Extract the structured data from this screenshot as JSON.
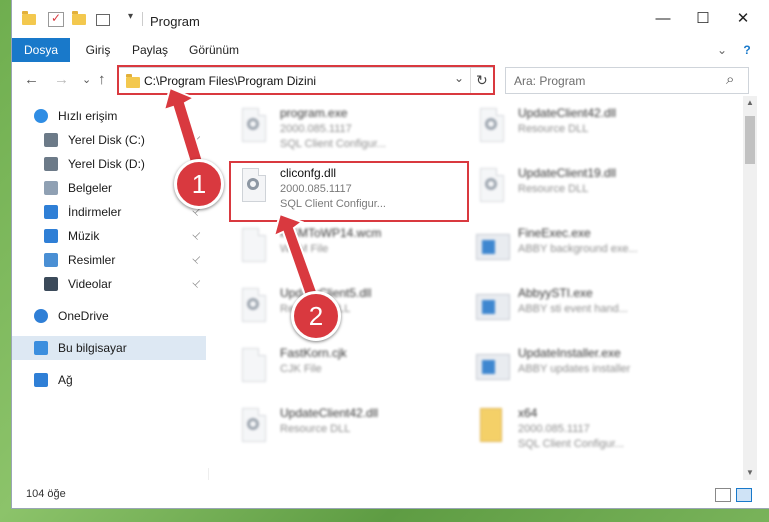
{
  "window": {
    "title": "Program",
    "minimize_glyph": "—",
    "maximize_glyph": "☐",
    "close_glyph": "✕"
  },
  "ribbon": {
    "tabs": [
      "Dosya",
      "Giriş",
      "Paylaş",
      "Görünüm"
    ],
    "expand_glyph": "⌄",
    "help_glyph": "?"
  },
  "nav": {
    "back_glyph": "←",
    "forward_glyph": "→",
    "recent_glyph": "⌄",
    "up_glyph": "↑",
    "address": "C:\\Program Files\\Program Dizini",
    "dropdown_glyph": "⌄",
    "refresh_glyph": "↻",
    "search_placeholder": "Ara: Program",
    "search_glyph": "⌕"
  },
  "sidebar": {
    "items": [
      {
        "label": "Hızlı erişim",
        "icon": "star-icon",
        "pinned": false
      },
      {
        "label": "Yerel Disk (C:)",
        "icon": "drive-icon",
        "pinned": true
      },
      {
        "label": "Yerel Disk (D:)",
        "icon": "drive-icon",
        "pinned": true
      },
      {
        "label": "Belgeler",
        "icon": "documents-icon",
        "pinned": true
      },
      {
        "label": "İndirmeler",
        "icon": "download-icon",
        "pinned": true
      },
      {
        "label": "Müzik",
        "icon": "music-icon",
        "pinned": true
      },
      {
        "label": "Resimler",
        "icon": "pictures-icon",
        "pinned": true
      },
      {
        "label": "Videolar",
        "icon": "video-icon",
        "pinned": true
      },
      {
        "label": "OneDrive",
        "icon": "cloud-icon",
        "pinned": false
      },
      {
        "label": "Bu bilgisayar",
        "icon": "computer-icon",
        "pinned": false
      },
      {
        "label": "Ağ",
        "icon": "network-icon",
        "pinned": false
      }
    ],
    "pin_glyph": "📌"
  },
  "files": [
    {
      "name": "program.exe",
      "line2": "2000.085.1117",
      "line3": "SQL Client Configur...",
      "icon": "installer-icon",
      "blurred": true
    },
    {
      "name": "UpdateClient42.dll",
      "line2": "Resource DLL",
      "line3": "",
      "icon": "dll-icon",
      "blurred": true
    },
    {
      "name": "cliconfg.dll",
      "line2": "2000.085.1117",
      "line3": "SQL Client Configur...",
      "icon": "dll-gear-icon",
      "blurred": false
    },
    {
      "name": "UpdateClient19.dll",
      "line2": "Resource DLL",
      "line3": "",
      "icon": "dll-icon",
      "blurred": true
    },
    {
      "name": "MSMToWP14.wcm",
      "line2": "WCM File",
      "line3": "",
      "icon": "file-icon",
      "blurred": true
    },
    {
      "name": "FineExec.exe",
      "line2": "ABBY background exe...",
      "line3": "",
      "icon": "exe-icon",
      "blurred": true
    },
    {
      "name": "UpdateClient5.dll",
      "line2": "Resource DLL",
      "line3": "",
      "icon": "dll-icon",
      "blurred": true
    },
    {
      "name": "AbbyySTI.exe",
      "line2": "ABBY sti event hand...",
      "line3": "",
      "icon": "exe-icon",
      "blurred": true
    },
    {
      "name": "FastKorn.cjk",
      "line2": "CJK File",
      "line3": "",
      "icon": "file-icon",
      "blurred": true
    },
    {
      "name": "UpdateInstaller.exe",
      "line2": "ABBY updates installer",
      "line3": "",
      "icon": "exe-icon",
      "blurred": true
    },
    {
      "name": "UpdateClient42.dll",
      "line2": "Resource DLL",
      "line3": "",
      "icon": "dll-icon",
      "blurred": true
    },
    {
      "name": "x64",
      "line2": "2000.085.1117",
      "line3": "SQL Client Configur...",
      "icon": "archive-icon",
      "blurred": true
    }
  ],
  "status": {
    "item_count": "104 öğe"
  },
  "annotations": {
    "step1": "1",
    "step2": "2",
    "color": "#d9393f"
  }
}
